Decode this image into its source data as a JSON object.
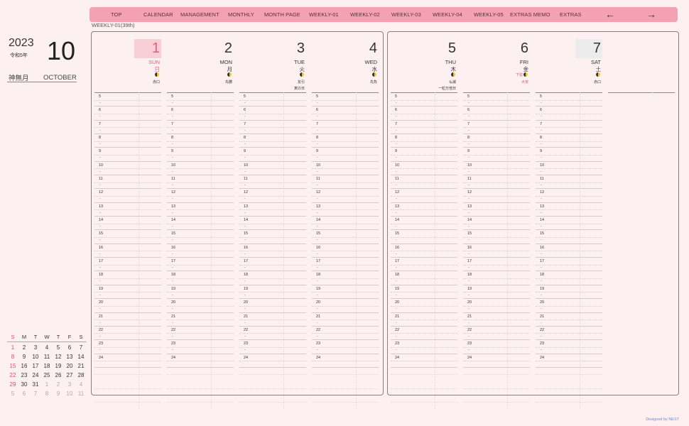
{
  "nav": {
    "items": [
      "TOP",
      "CALENDAR",
      "MANAGEMENT",
      "MONTHLY",
      "MONTH PAGE",
      "WEEKLY-01",
      "WEEKLY-02",
      "WEEKLY-03",
      "WEEKLY-04",
      "WEEKLY-05",
      "EXTRAS MEMO",
      "EXTRAS"
    ],
    "prev_arrow": "←",
    "next_arrow": "→"
  },
  "week_label": "WEEKLY-01(39th)",
  "header": {
    "year": "2023",
    "era": "令和5年",
    "month": "10",
    "month_jp": "神無月",
    "month_en": "OCTOBER"
  },
  "mini_calendar": {
    "weekdays": [
      "S",
      "M",
      "T",
      "W",
      "T",
      "F",
      "S"
    ],
    "weeks": [
      [
        "1",
        "2",
        "3",
        "4",
        "5",
        "6",
        "7"
      ],
      [
        "8",
        "9",
        "10",
        "11",
        "12",
        "13",
        "14"
      ],
      [
        "15",
        "16",
        "17",
        "18",
        "19",
        "20",
        "21"
      ],
      [
        "22",
        "23",
        "24",
        "25",
        "26",
        "27",
        "28"
      ],
      [
        "29",
        "30",
        "31",
        "1",
        "2",
        "3",
        "4"
      ],
      [
        "5",
        "6",
        "7",
        "8",
        "9",
        "10",
        "11"
      ]
    ]
  },
  "days": [
    {
      "num": "1",
      "en": "SUN",
      "jp": "日",
      "moon_label": "",
      "rokuyo": "赤口",
      "note": ""
    },
    {
      "num": "2",
      "en": "MON",
      "jp": "月",
      "moon_label": "",
      "rokuyo": "先勝",
      "note": ""
    },
    {
      "num": "3",
      "en": "TUE",
      "jp": "火",
      "moon_label": "",
      "rokuyo": "友引",
      "note": "寅の日"
    },
    {
      "num": "4",
      "en": "WED",
      "jp": "水",
      "moon_label": "",
      "rokuyo": "先負",
      "note": ""
    },
    {
      "num": "5",
      "en": "THU",
      "jp": "木",
      "moon_label": "",
      "rokuyo": "仏滅",
      "note": "一粒万倍日"
    },
    {
      "num": "6",
      "en": "FRI",
      "jp": "金",
      "moon_label": "下弦",
      "rokuyo": "大安",
      "note": ""
    },
    {
      "num": "7",
      "en": "SAT",
      "jp": "土",
      "moon_label": "",
      "rokuyo": "赤口",
      "note": ""
    }
  ],
  "hours": [
    "5",
    "6",
    "7",
    "8",
    "9",
    "10",
    "11",
    "12",
    "13",
    "14",
    "15",
    "16",
    "17",
    "18",
    "19",
    "20",
    "21",
    "22",
    "23",
    "24"
  ],
  "hour_dash": "-",
  "credit": "Designed by NEST",
  "colors": {
    "accent": "#f4a1b2",
    "sunday": "#e55f7b",
    "background": "#fdf0f1"
  }
}
